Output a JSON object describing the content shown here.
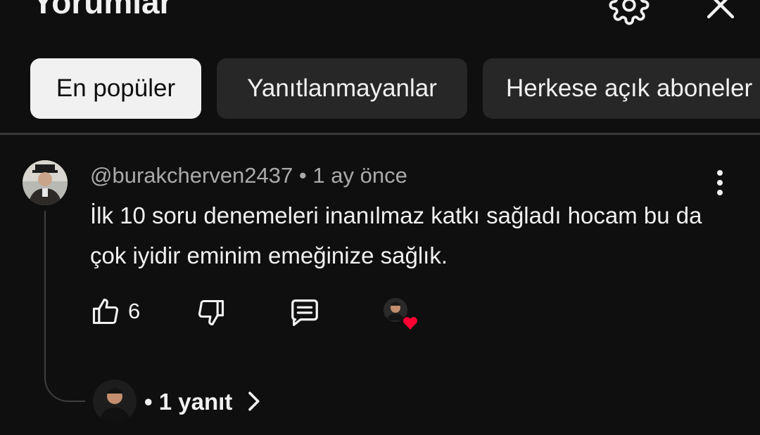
{
  "header": {
    "title": "Yorumlar",
    "settings_icon": "gear-icon",
    "close_icon": "close-icon"
  },
  "chips": [
    {
      "label": "En popüler",
      "active": true
    },
    {
      "label": "Yanıtlanmayanlar",
      "active": false
    },
    {
      "label": "Herkese açık aboneler",
      "active": false
    }
  ],
  "comment": {
    "author": "@burakcherven2437",
    "time": "1 ay önce",
    "meta_separator": "•",
    "text": "İlk 10 soru denemeleri inanılmaz katkı sağladı hocam bu da çok iyidir eminim emeğinize sağlık.",
    "likes": "6",
    "creator_heart": true
  },
  "replies": {
    "label": "• 1 yanıt"
  },
  "colors": {
    "background": "#0f0f0f",
    "chip_active": "#f1f1f1",
    "chip_idle": "#272727",
    "heart": "#ff0033",
    "meta_text": "#aaaaaa"
  }
}
